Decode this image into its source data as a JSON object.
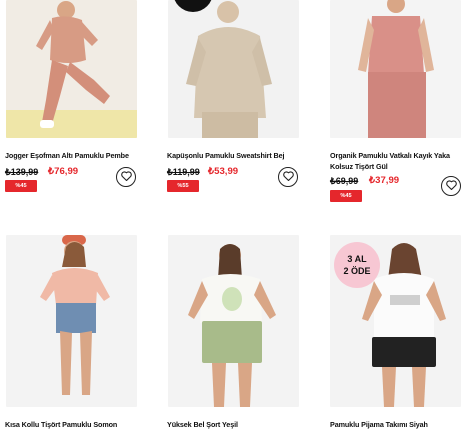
{
  "products": [
    {
      "title": "Jogger Eşofman Altı Pamuklu Pembe",
      "old_price": "₺139,99",
      "new_price": "₺76,99",
      "discount": "%45",
      "image": "pink-jogger-photo"
    },
    {
      "title": "Kapüşonlu Pamuklu Sweatshirt Bej",
      "old_price": "₺119,99",
      "new_price": "₺53,99",
      "discount": "%55",
      "image": "beige-hoodie-photo"
    },
    {
      "title": "Organik Pamuklu Vatkalı Kayık Yaka Kolsuz Tişört Gül",
      "old_price": "₺69,99",
      "new_price": "₺37,99",
      "discount": "%45",
      "image": "rose-top-photo"
    },
    {
      "title": "Kısa Kollu Tişört Pamuklu Somon",
      "image": "salmon-tee-photo"
    },
    {
      "title": "Yüksek Bel Şort Yeşil",
      "image": "green-shorts-photo"
    },
    {
      "title": "Pamuklu Pijama Takımı Siyah",
      "image": "black-pajama-photo",
      "promo": [
        "3 AL",
        "2 ÖDE"
      ]
    }
  ],
  "icons": {
    "favorite": "heart-outline-icon"
  },
  "colors": {
    "sale": "#e5272c",
    "promo_bg": "#f7c7d3"
  }
}
